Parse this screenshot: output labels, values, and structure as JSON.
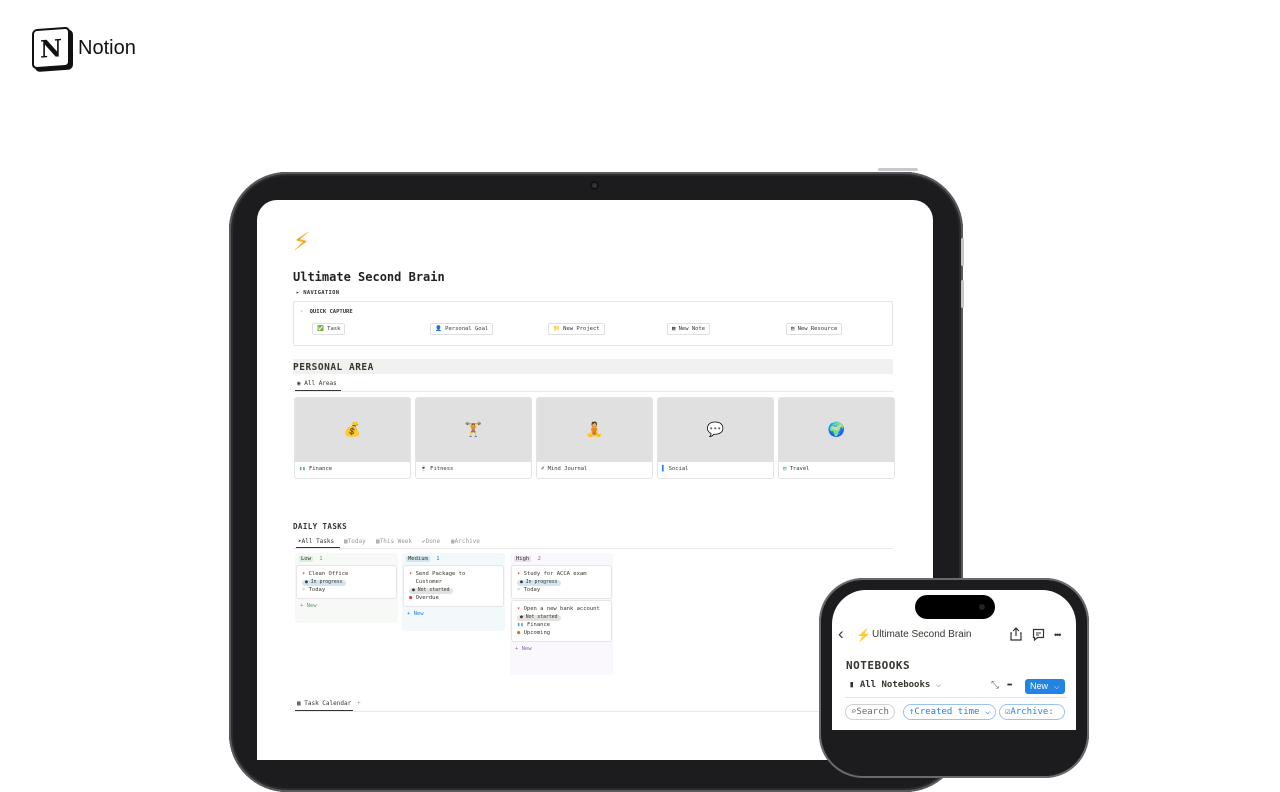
{
  "brand": {
    "name": "Notion",
    "logo_letter": "N"
  },
  "page": {
    "icon": "⚡",
    "title": "Ultimate Second Brain",
    "navigation_label": "▸ NAVIGATION",
    "quick_capture": {
      "title": "QUICK CAPTURE",
      "icon": "⚡",
      "buttons": [
        {
          "icon": "✅",
          "label": "Task"
        },
        {
          "icon": "👤",
          "label": "Personal Goal"
        },
        {
          "icon": "📁",
          "label": "New Project"
        },
        {
          "icon": "▦",
          "label": "New Note"
        },
        {
          "icon": "▤",
          "label": "New Resource"
        }
      ]
    },
    "personal_area": {
      "heading": "PERSONAL AREA",
      "tab": "All Areas",
      "tab_icon": "◉",
      "areas": [
        {
          "icon": "▮▮",
          "label": "Finance",
          "emoji": "💰"
        },
        {
          "icon": "🍷",
          "label": "Fitness",
          "emoji": "🏋"
        },
        {
          "icon": "✐",
          "label": "Mind Journal",
          "emoji": "🧘"
        },
        {
          "icon": "▌",
          "label": "Social",
          "emoji": "💬"
        },
        {
          "icon": "▤",
          "label": "Travel",
          "emoji": "🌍"
        }
      ]
    },
    "daily_tasks": {
      "heading": "DAILY TASKS",
      "tabs": [
        {
          "icon": "➤",
          "label": "All Tasks"
        },
        {
          "icon": "▦",
          "label": "Today"
        },
        {
          "icon": "▦",
          "label": "This Week"
        },
        {
          "icon": "✔",
          "label": "Done"
        },
        {
          "icon": "▣",
          "label": "Archive"
        }
      ],
      "columns": [
        {
          "name": "Low",
          "count": "1",
          "tasks": [
            {
              "title": "Clean Office",
              "status": "In progress",
              "extra": [
                {
                  "icon": "☼",
                  "text": "Today"
                }
              ]
            }
          ],
          "new_label": "+ New"
        },
        {
          "name": "Medium",
          "count": "1",
          "tasks": [
            {
              "title": "Send Package to Customer",
              "status": "Not started",
              "extra": [
                {
                  "icon": "●",
                  "text": "Overdue"
                }
              ]
            }
          ],
          "new_label": "+ New"
        },
        {
          "name": "High",
          "count": "2",
          "tasks": [
            {
              "title": "Study for ACCA exam",
              "status": "In progress",
              "extra": [
                {
                  "icon": "☼",
                  "text": "Today"
                }
              ]
            },
            {
              "title": "Open a new bank account",
              "status": "Not started",
              "extra": [
                {
                  "icon": "▮▮",
                  "text": "Finance"
                },
                {
                  "icon": "●",
                  "text": "Upcoming"
                }
              ]
            }
          ],
          "new_label": "+ New"
        }
      ]
    },
    "calendar_tab": "Task Calendar",
    "calendar_add": "+"
  },
  "phone": {
    "back": "‹",
    "title_icon": "⚡",
    "title": "Ultimate Second Brain",
    "share_icon": "share-icon",
    "comment_icon": "comment-icon",
    "more": "•••",
    "heading": "NOTEBOOKS",
    "view_label": "All Notebooks",
    "view_icon": "▮",
    "chevron": "⌵",
    "expand": "⤡",
    "view_more": "•••",
    "new_button": "New",
    "filters": [
      {
        "icon": "⌕",
        "label": "Search"
      },
      {
        "icon": "↑",
        "label": "Created time ⌵"
      },
      {
        "icon": "☑",
        "label": "Archive:"
      }
    ]
  },
  "colors": {
    "low": "#edf3ec",
    "low_tag": "#dbeddb",
    "medium": "#e7f3f8",
    "medium_tag": "#d3e5ef",
    "high": "#f6f3f9",
    "high_tag": "#e8deee",
    "in_progress": "#d3e5ef",
    "not_started": "#e3e2e0",
    "accent_blue": "#2383e2",
    "bolt": "#f5a623",
    "overdue": "#e03e3e",
    "upcoming": "#d9730d"
  }
}
